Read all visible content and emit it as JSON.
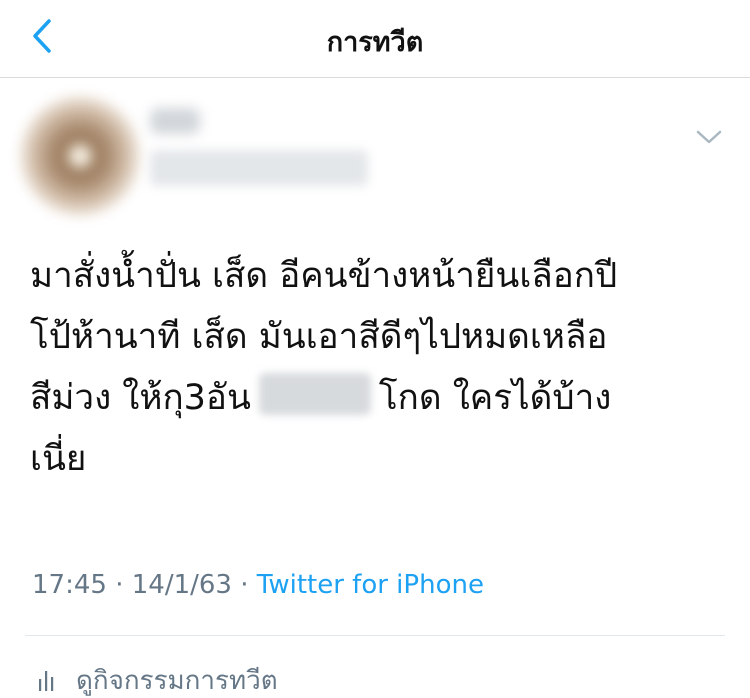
{
  "header": {
    "title": "การทวีต",
    "back_icon": "chevron-left-icon",
    "accent": "#1da1f2"
  },
  "tweet": {
    "lines": [
      "มาสั่งน้ำปั่น เส็ด อีคนข้างหน้ายืนเลือกปี",
      "โป้ห้านาที เส็ด มันเอาสีดีๆไปหมดเหลือ",
      "สีม่วง ให้กุ3อัน",
      "โกด ใครได้บ้าง",
      "เนี่ย"
    ],
    "caret_icon": "chevron-down-icon"
  },
  "meta": {
    "time": "17:45",
    "separator": " · ",
    "date": "14/1/63",
    "source": "Twitter for iPhone"
  },
  "activity": {
    "label": "ดูกิจกรรมการทวีต",
    "icon": "bar-chart-icon"
  }
}
